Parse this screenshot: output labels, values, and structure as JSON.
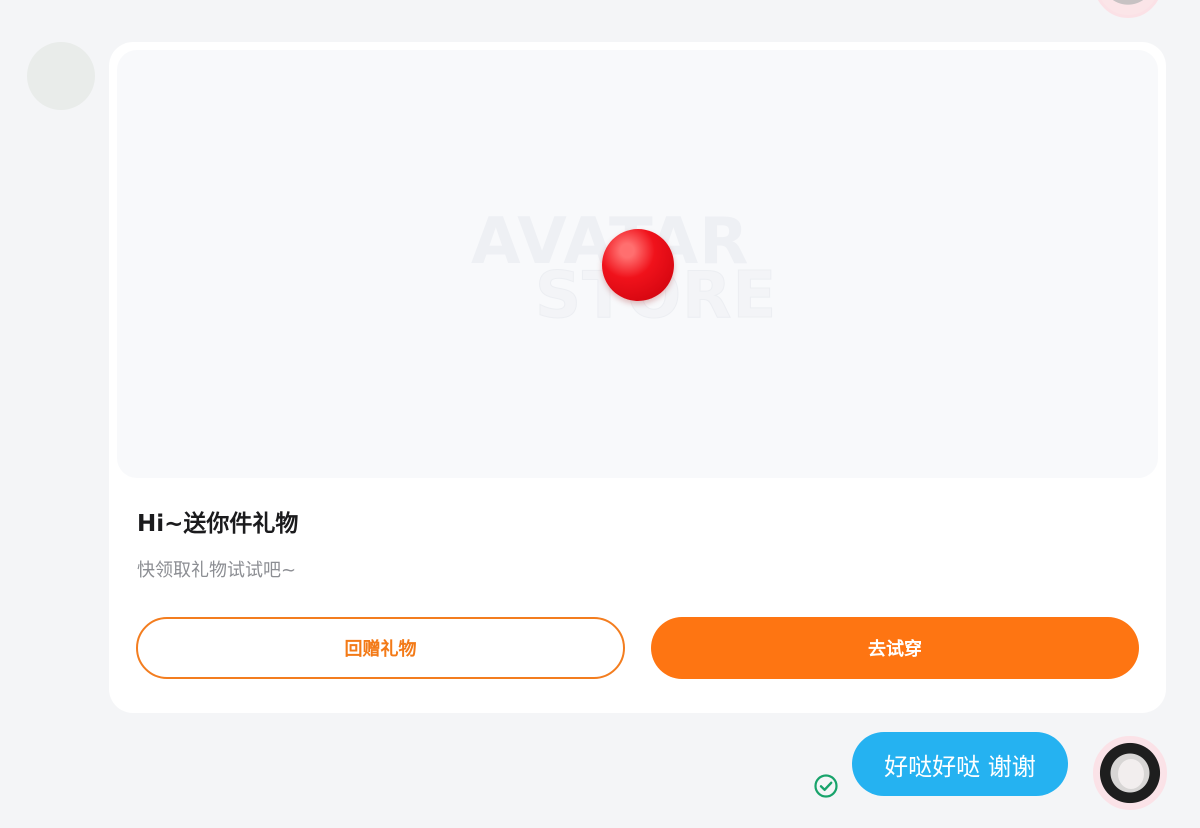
{
  "card": {
    "title": "Hi~送你件礼物",
    "subtitle": "快领取礼物试试吧~",
    "watermark_line1": "AVATAR",
    "watermark_line2": "STORE",
    "return_gift_label": "回赠礼物",
    "try_on_label": "去试穿"
  },
  "reply": {
    "text": "好哒好哒 谢谢"
  },
  "colors": {
    "accent_orange": "#fe7512",
    "bubble_blue": "#25b2f1",
    "read_check_green": "#18a36b"
  },
  "icons": {
    "read_status": "check-circle-icon",
    "gift_preview": "red-ball-item"
  }
}
